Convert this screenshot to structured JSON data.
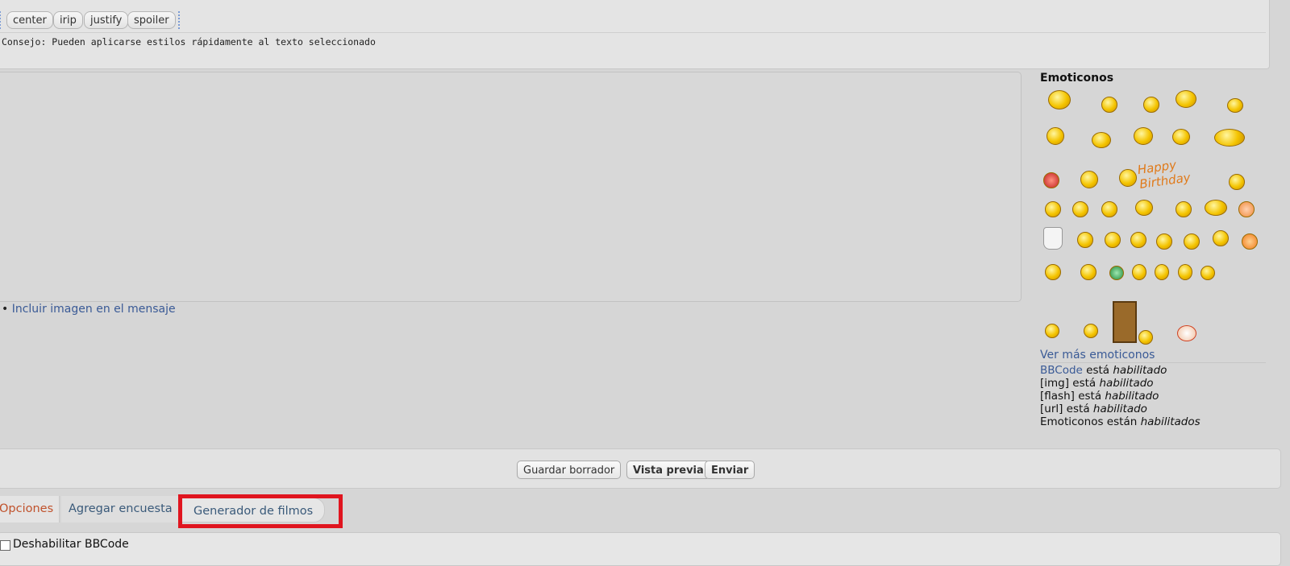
{
  "toolbar": {
    "buttons": [
      "center",
      "irip",
      "justify",
      "spoiler"
    ],
    "tip": "Consejo: Pueden aplicarse estilos rápidamente al texto seleccionado"
  },
  "editor": {
    "include_image_bullet": "•",
    "include_image_link": "Incluir imagen en el mensaje"
  },
  "emoticons": {
    "title": "Emoticonos",
    "more_link": "Ver más emoticonos",
    "status": {
      "bbcode_link": "BBCode",
      "bbcode_text": " está ",
      "bbcode_state": "habilitado",
      "img_text": "[img] está ",
      "img_state": "habilitado",
      "flash_text": "[flash] está ",
      "flash_state": "habilitado",
      "url_text": "[url] está ",
      "url_state": "habilitado",
      "emo_text": "Emoticonos están ",
      "emo_state": "habilitados"
    }
  },
  "actions": {
    "save_draft": "Guardar borrador",
    "preview": "Vista previa",
    "submit": "Enviar"
  },
  "tabs": {
    "options": "Opciones",
    "poll": "Agregar encuesta",
    "movie_generator": "Generador de filmos"
  },
  "options": {
    "disable_bbcode": "Deshabilitar BBCode"
  },
  "colors": {
    "link": "#3a5a96",
    "active_tab": "#c0522c",
    "highlight": "#e0151f",
    "smiley": "#f4c400"
  }
}
